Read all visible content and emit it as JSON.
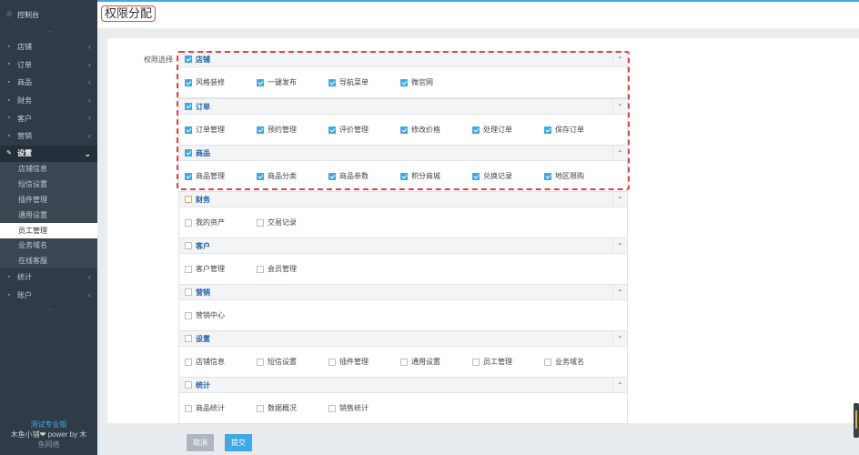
{
  "sidebar": {
    "dashboard": "控制台",
    "items": [
      {
        "label": "店铺",
        "icon": "store-icon"
      },
      {
        "label": "订单",
        "icon": "order-icon"
      },
      {
        "label": "商品",
        "icon": "goods-icon"
      },
      {
        "label": "财务",
        "icon": "finance-icon"
      },
      {
        "label": "客户",
        "icon": "customer-icon"
      },
      {
        "label": "营销",
        "icon": "marketing-icon"
      }
    ],
    "settings": "设置",
    "settings_sub": [
      "店铺信息",
      "短信设置",
      "插件管理",
      "通用设置",
      "员工管理",
      "业务域名",
      "在线客服"
    ],
    "current_sub": "员工管理",
    "items_after": [
      {
        "label": "统计",
        "icon": "stats-icon"
      },
      {
        "label": "账户",
        "icon": "account-icon"
      }
    ],
    "footer": {
      "version": "测试专业版",
      "powered_line1": "木鱼小铺❤ power by 木",
      "powered_line2": "鱼网络"
    }
  },
  "header": {
    "title": "权限分配"
  },
  "form": {
    "label": "权限选择",
    "groups": [
      {
        "name": "店铺",
        "checked": true,
        "options": [
          {
            "label": "风格装修",
            "checked": true
          },
          {
            "label": "一键发布",
            "checked": true
          },
          {
            "label": "导航菜单",
            "checked": true
          },
          {
            "label": "微官网",
            "checked": true
          }
        ]
      },
      {
        "name": "订单",
        "checked": true,
        "options": [
          {
            "label": "订单管理",
            "checked": true
          },
          {
            "label": "预约管理",
            "checked": true
          },
          {
            "label": "评价管理",
            "checked": true
          },
          {
            "label": "修改价格",
            "checked": true
          },
          {
            "label": "处理订单",
            "checked": true
          },
          {
            "label": "保存订单",
            "checked": true
          }
        ]
      },
      {
        "name": "商品",
        "checked": true,
        "options": [
          {
            "label": "商品管理",
            "checked": true
          },
          {
            "label": "商品分类",
            "checked": true
          },
          {
            "label": "商品参数",
            "checked": true
          },
          {
            "label": "积分商城",
            "checked": true
          },
          {
            "label": "兑换记录",
            "checked": true
          },
          {
            "label": "地区限购",
            "checked": true
          }
        ]
      },
      {
        "name": "财务",
        "checked": false,
        "options": [
          {
            "label": "我的资产",
            "checked": false
          },
          {
            "label": "交易记录",
            "checked": false
          }
        ]
      },
      {
        "name": "客户",
        "checked": false,
        "options": [
          {
            "label": "客户管理",
            "checked": false
          },
          {
            "label": "会员管理",
            "checked": false
          }
        ]
      },
      {
        "name": "营销",
        "checked": false,
        "options": [
          {
            "label": "营销中心",
            "checked": false
          }
        ]
      },
      {
        "name": "设置",
        "checked": false,
        "options": [
          {
            "label": "店铺信息",
            "checked": false
          },
          {
            "label": "短信设置",
            "checked": false
          },
          {
            "label": "插件管理",
            "checked": false
          },
          {
            "label": "通用设置",
            "checked": false
          },
          {
            "label": "员工管理",
            "checked": false
          },
          {
            "label": "业务域名",
            "checked": false
          }
        ]
      },
      {
        "name": "统计",
        "checked": false,
        "options": [
          {
            "label": "商品统计",
            "checked": false
          },
          {
            "label": "数据概况",
            "checked": false
          },
          {
            "label": "销售统计",
            "checked": false
          }
        ]
      }
    ]
  },
  "actions": {
    "cancel": "取消",
    "submit": "提交"
  },
  "colors": {
    "accent": "#3fa9e8",
    "sidebar": "#2f3b46",
    "highlight": "#e04545"
  }
}
